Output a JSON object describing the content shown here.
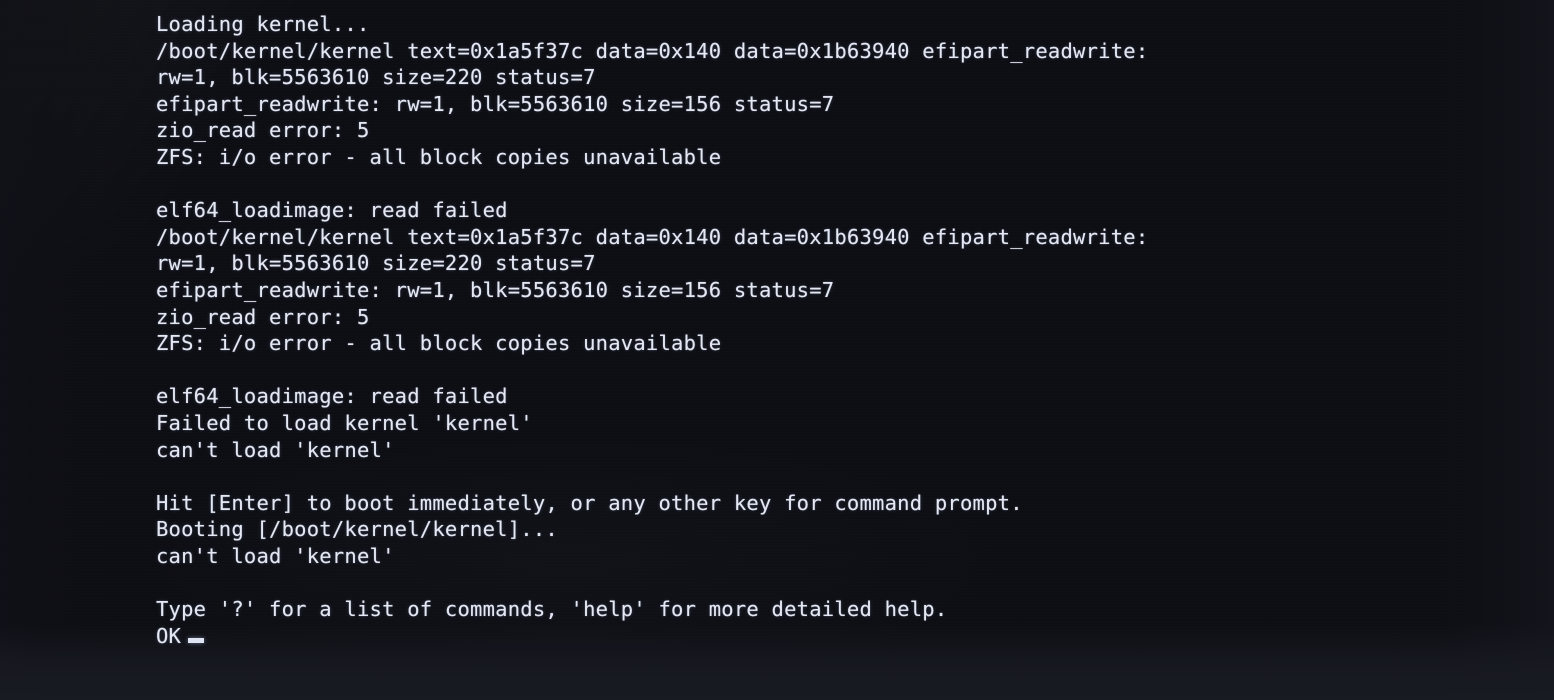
{
  "screen": {
    "kind": "bios-bootloader-console",
    "background_color": "#0d0e13",
    "text_color": "#e4e8f3",
    "bezel_color": "#191b22"
  },
  "console": {
    "lines": [
      "Loading kernel...",
      "/boot/kernel/kernel text=0x1a5f37c data=0x140 data=0x1b63940 efipart_readwrite:",
      "rw=1, blk=5563610 size=220 status=7",
      "efipart_readwrite: rw=1, blk=5563610 size=156 status=7",
      "zio_read error: 5",
      "ZFS: i/o error - all block copies unavailable",
      "",
      "elf64_loadimage: read failed",
      "/boot/kernel/kernel text=0x1a5f37c data=0x140 data=0x1b63940 efipart_readwrite:",
      "rw=1, blk=5563610 size=220 status=7",
      "efipart_readwrite: rw=1, blk=5563610 size=156 status=7",
      "zio_read error: 5",
      "ZFS: i/o error - all block copies unavailable",
      "",
      "elf64_loadimage: read failed",
      "Failed to load kernel 'kernel'",
      "can't load 'kernel'",
      "",
      "Hit [Enter] to boot immediately, or any other key for command prompt.",
      "Booting [/boot/kernel/kernel]...",
      "can't load 'kernel'",
      "",
      "Type '?' for a list of commands, 'help' for more detailed help."
    ],
    "prompt": "OK",
    "cursor": "_"
  }
}
